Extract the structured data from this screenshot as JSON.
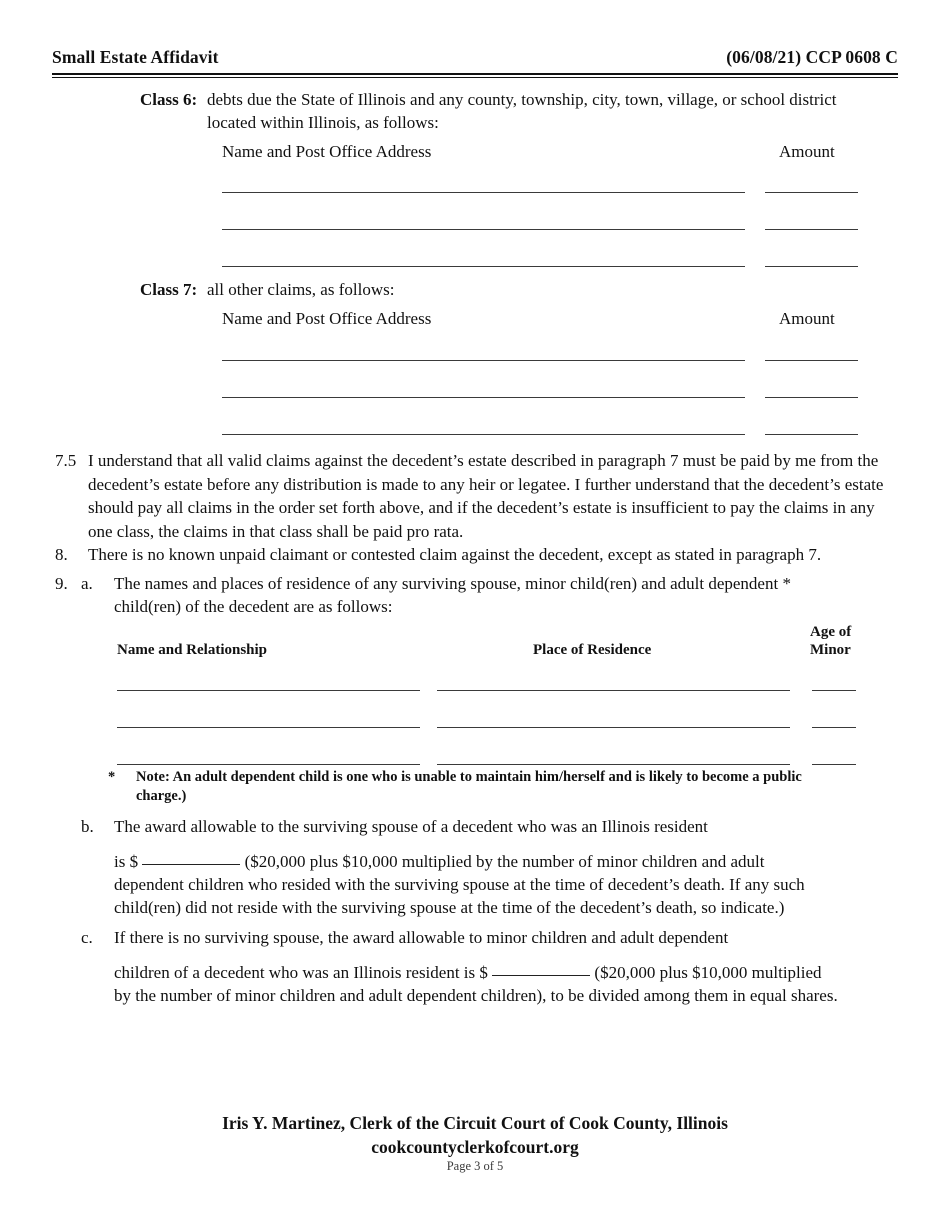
{
  "header": {
    "title": "Small Estate Affidavit",
    "form_code": "(06/08/21) CCP 0608 C"
  },
  "classes": [
    {
      "label": "Class 6:",
      "text": "debts due the State of Illinois and any county, township, city, town, village, or school district",
      "text_cont": "located within Illinois, as follows:",
      "name_header": "Name and Post Office Address",
      "amount_header": "Amount"
    },
    {
      "label": "Class 7:",
      "text": "all other claims, as follows:",
      "name_header": "Name and Post Office Address",
      "amount_header": "Amount"
    }
  ],
  "paragraphs": [
    {
      "number": "7.5",
      "text": "I understand that all valid claims against the decedent’s estate described in paragraph 7 must be paid by me from the decedent’s estate before any distribution is made to any heir or legatee.  I further understand that the decedent’s estate should pay all claims in the order set forth above, and if the decedent’s estate is insufficient to pay the claims in any one class, the claims in that class shall be paid pro rata."
    },
    {
      "number": "8.",
      "text": "There is no known unpaid claimant or contested claim against the decedent, except as stated in paragraph 7."
    }
  ],
  "item9": {
    "number": "9.",
    "a": {
      "marker": "a.",
      "line1": "The names and places of residence of any surviving spouse, minor child(ren) and adult dependent *",
      "line2": "child(ren) of the decedent are as follows:",
      "table_headers": {
        "name": "Name and Relationship",
        "residence": "Place of Residence",
        "age_line1": "Age of",
        "age_line2": "Minor"
      },
      "note_star": "*",
      "note_line1": "Note: An adult dependent child is one who is unable to maintain him/herself and is likely to become a public",
      "note_line2": "charge.)"
    },
    "b": {
      "marker": "b.",
      "line1": "The award allowable to the surviving spouse of a decedent who was an Illinois resident",
      "line2_pre": "is $",
      "line2_post": "($20,000 plus $10,000 multiplied by the number of minor children and adult",
      "line3": "dependent children who resided with the surviving spouse at the time of decedent’s death.  If any such",
      "line4": "child(ren) did not reside with the surviving spouse at the time of the decedent’s death, so indicate.)"
    },
    "c": {
      "marker": "c.",
      "line1": "If there is no surviving spouse, the award allowable to minor children and adult dependent",
      "line2_pre": "children of a decedent who was an Illinois resident is $",
      "line2_post": "($20,000 plus $10,000 multiplied",
      "line3": "by the number of minor children and adult dependent children), to be divided among them in equal shares."
    }
  },
  "footer": {
    "clerk_line": "Iris Y. Martinez, Clerk of the Circuit Court of Cook County, Illinois",
    "website": "cookcountyclerkofcourt.org",
    "page_label": "Page 3 of 5"
  }
}
